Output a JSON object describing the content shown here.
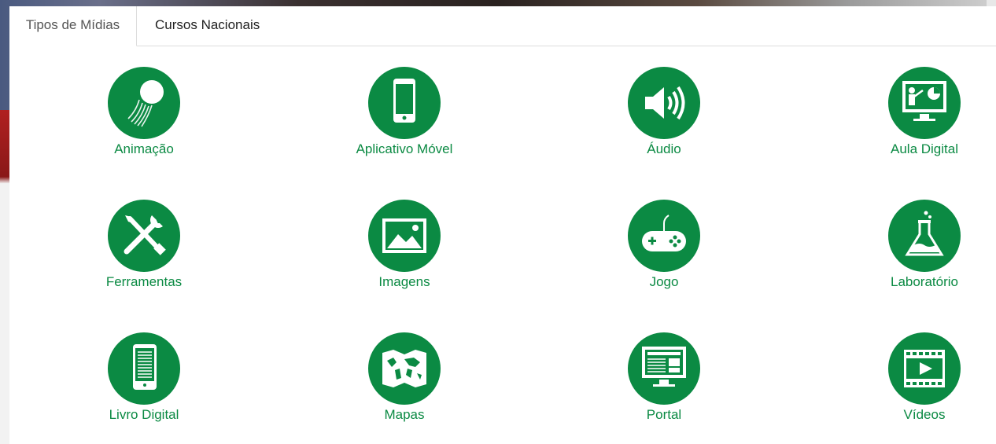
{
  "tabs": [
    {
      "label": "Tipos de Mídias",
      "active": true
    },
    {
      "label": "Cursos Nacionais",
      "active": false
    }
  ],
  "accent_color": "#0b8a43",
  "media_types": [
    {
      "label": "Animação",
      "icon": "animation-ball-icon"
    },
    {
      "label": "Aplicativo Móvel",
      "icon": "smartphone-icon"
    },
    {
      "label": "Áudio",
      "icon": "speaker-icon"
    },
    {
      "label": "Aula Digital",
      "icon": "presentation-icon"
    },
    {
      "label": "Ferramentas",
      "icon": "tools-icon"
    },
    {
      "label": "Imagens",
      "icon": "image-icon"
    },
    {
      "label": "Jogo",
      "icon": "gamepad-icon"
    },
    {
      "label": "Laboratório",
      "icon": "flask-icon"
    },
    {
      "label": "Livro Digital",
      "icon": "ebook-reader-icon"
    },
    {
      "label": "Mapas",
      "icon": "map-icon"
    },
    {
      "label": "Portal",
      "icon": "portal-monitor-icon"
    },
    {
      "label": "Vídeos",
      "icon": "video-film-icon"
    }
  ]
}
